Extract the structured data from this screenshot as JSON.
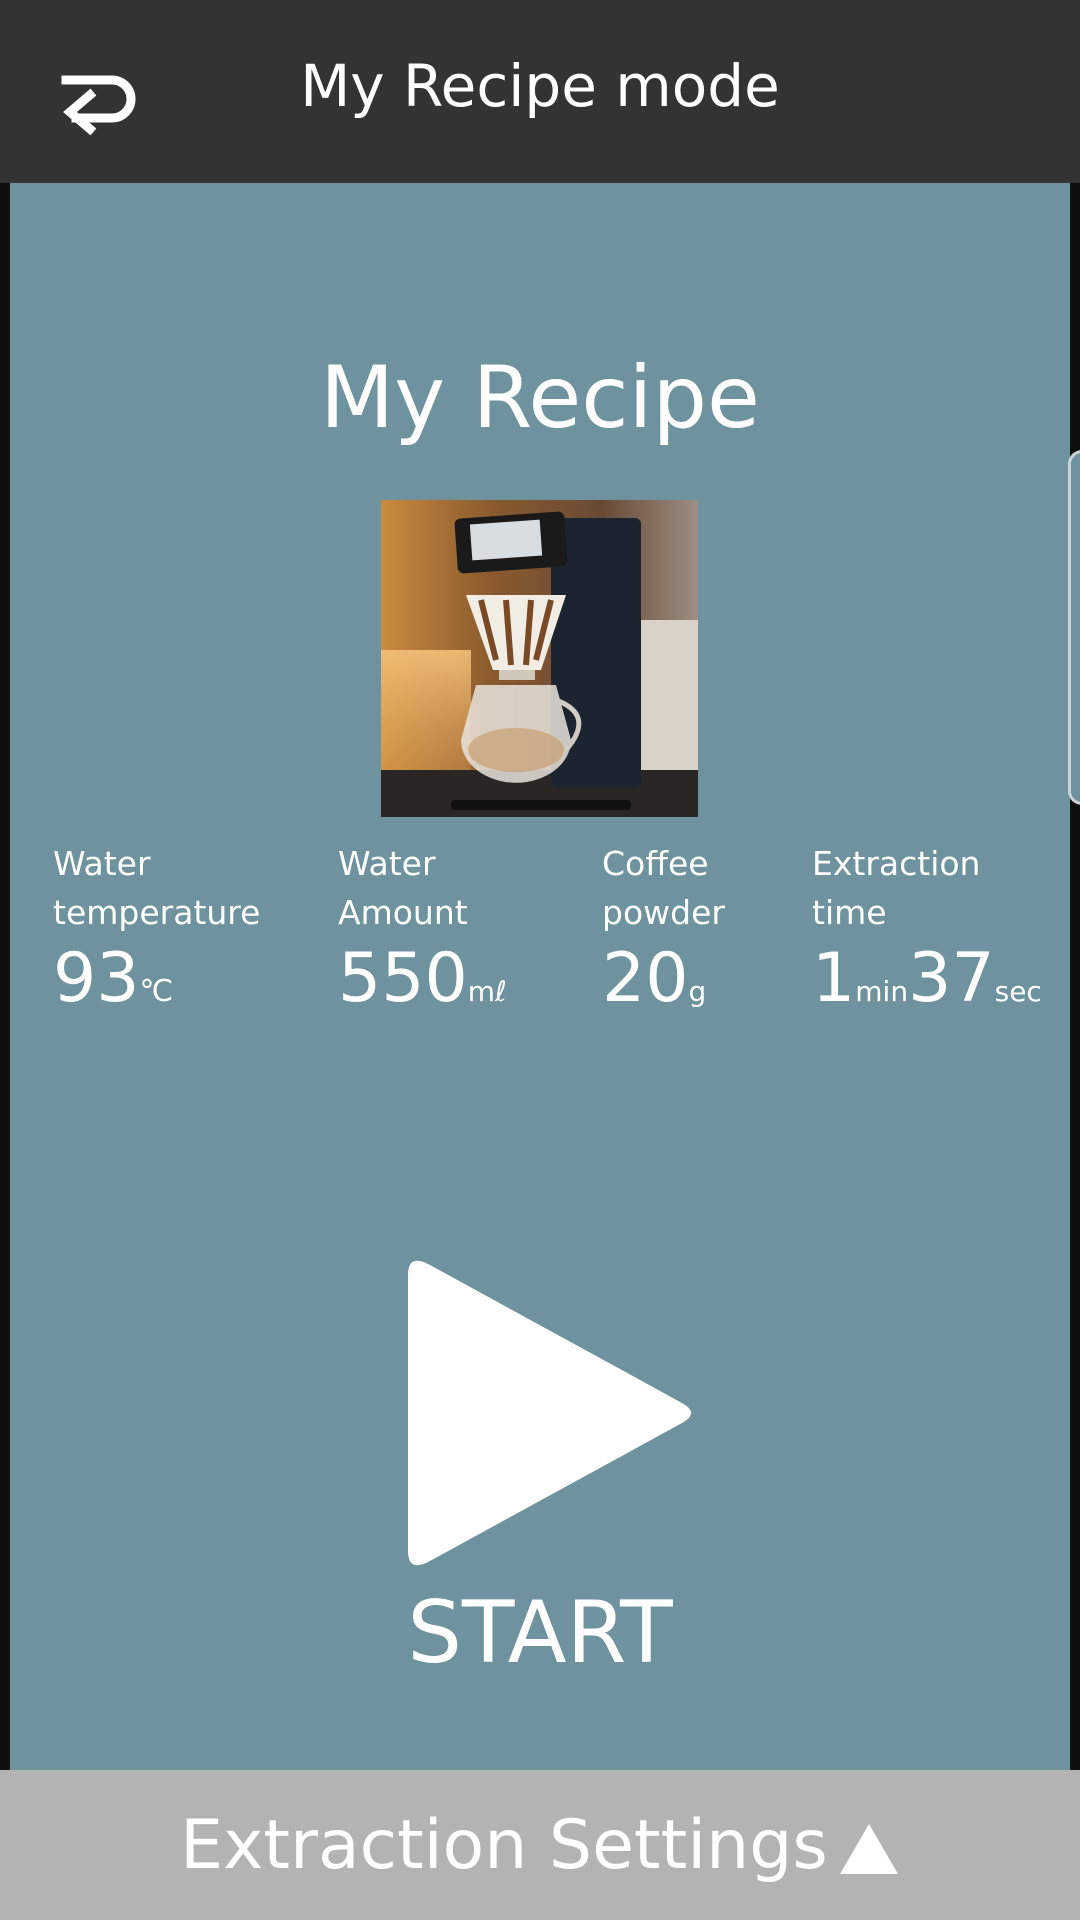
{
  "header": {
    "title": "My Recipe mode",
    "back_icon": "return-arrow-icon"
  },
  "recipe": {
    "title": "My Recipe",
    "image": "coffee-dripper-machine-photo"
  },
  "stats": [
    {
      "label": "Water temperature",
      "value": "93",
      "unit": "℃"
    },
    {
      "label": "Water Amount",
      "value": "550",
      "unit": "mℓ"
    },
    {
      "label": "Coffee powder",
      "value": "20",
      "unit": "g"
    },
    {
      "label": "Extraction time",
      "min_value": "1",
      "min_unit": "min",
      "sec_value": "37",
      "sec_unit": "sec"
    }
  ],
  "start": {
    "label": "START",
    "icon": "play-icon"
  },
  "footer": {
    "label": "Extraction Settings",
    "icon": "triangle-up-icon"
  },
  "colors": {
    "topbar": "#333333",
    "panel": "#6e929e",
    "footer": "#b3b3b3",
    "text": "#ffffff"
  }
}
